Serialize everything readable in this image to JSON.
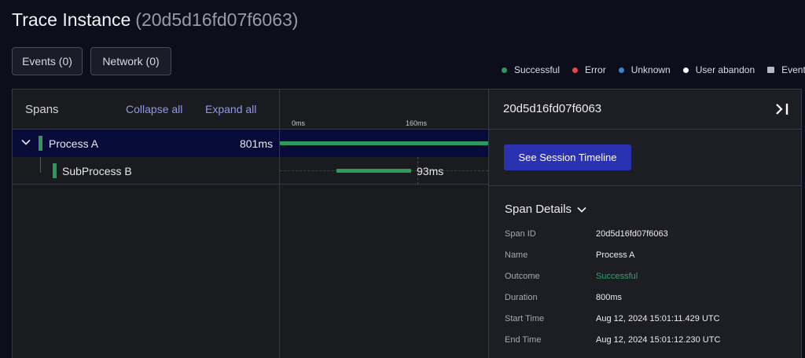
{
  "header": {
    "title": "Trace Instance",
    "trace_id": "(20d5d16fd07f6063)"
  },
  "tabs": [
    {
      "label": "Events (0)"
    },
    {
      "label": "Network (0)"
    }
  ],
  "legend": [
    {
      "label": "Successful",
      "color": "#2c9a5b",
      "shape": "dot"
    },
    {
      "label": "Error",
      "color": "#e5484d",
      "shape": "dot"
    },
    {
      "label": "Unknown",
      "color": "#3a86c8",
      "shape": "dot"
    },
    {
      "label": "User abandon",
      "color": "#ffffff",
      "shape": "dot"
    },
    {
      "label": "Events",
      "color": "#b8b8bf",
      "shape": "square"
    }
  ],
  "spans_panel": {
    "title": "Spans",
    "collapse_all": "Collapse all",
    "expand_all": "Expand all",
    "rows": [
      {
        "name": "Process A",
        "duration": "801ms"
      },
      {
        "name": "SubProcess B",
        "duration": "93ms"
      }
    ]
  },
  "timeline": {
    "ticks": [
      "0ms",
      "160ms"
    ]
  },
  "details": {
    "span_id_header": "20d5d16fd07f6063",
    "session_button": "See Session Timeline",
    "section_title": "Span Details",
    "fields": [
      {
        "key": "Span ID",
        "value": "20d5d16fd07f6063"
      },
      {
        "key": "Name",
        "value": "Process A"
      },
      {
        "key": "Outcome",
        "value": "Successful"
      },
      {
        "key": "Duration",
        "value": "800ms"
      },
      {
        "key": "Start Time",
        "value": "Aug 12, 2024 15:01:11.429 UTC"
      },
      {
        "key": "End Time",
        "value": "Aug 12, 2024 15:01:12.230 UTC"
      }
    ]
  },
  "colors": {
    "success": "#2c9a5b",
    "accent": "#2b32b2",
    "link": "#8f97ee",
    "selected_row": "#070b38"
  }
}
